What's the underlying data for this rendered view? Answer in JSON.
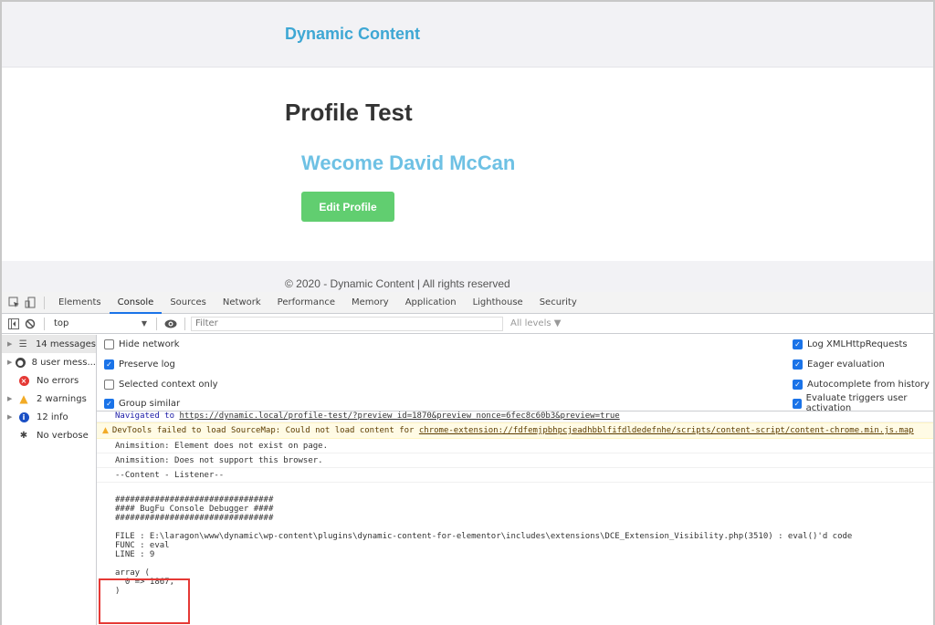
{
  "site": {
    "brand": "Dynamic Content",
    "page_title": "Profile Test",
    "welcome": "Wecome David McCan",
    "edit_button": "Edit Profile",
    "footer": "© 2020 - Dynamic Content | All rights reserved",
    "colors": {
      "brand": "#3ea7d4",
      "welcome": "#6ec1e4",
      "button": "#61ce70"
    }
  },
  "devtools": {
    "tabs": [
      "Elements",
      "Console",
      "Sources",
      "Network",
      "Performance",
      "Memory",
      "Application",
      "Lighthouse",
      "Security"
    ],
    "active_tab": "Console",
    "toolbar": {
      "context": "top",
      "filter_placeholder": "Filter",
      "levels": "All levels ▼"
    },
    "sidebar": [
      {
        "label": "14 messages",
        "icon": "list-icon"
      },
      {
        "label": "8 user mess...",
        "icon": "user-icon"
      },
      {
        "label": "No errors",
        "icon": "error-icon"
      },
      {
        "label": "2 warnings",
        "icon": "warning-icon"
      },
      {
        "label": "12 info",
        "icon": "info-icon"
      },
      {
        "label": "No verbose",
        "icon": "bug-icon"
      }
    ],
    "settings_left": [
      {
        "label": "Hide network",
        "checked": false
      },
      {
        "label": "Preserve log",
        "checked": true
      },
      {
        "label": "Selected context only",
        "checked": false
      },
      {
        "label": "Group similar",
        "checked": true
      }
    ],
    "settings_right": [
      {
        "label": "Log XMLHttpRequests",
        "checked": true
      },
      {
        "label": "Eager evaluation",
        "checked": true
      },
      {
        "label": "Autocomplete from history",
        "checked": true
      },
      {
        "label": "Evaluate triggers user activation",
        "checked": true
      }
    ],
    "console": {
      "nav_prefix": "Navigated to ",
      "nav_url": "https://dynamic.local/profile-test/?preview_id=1870&preview_nonce=6fec8c60b3&preview=true",
      "warn_text": "DevTools failed to load SourceMap: Could not load content for ",
      "warn_url": "chrome-extension://fdfemjpbhpcjeadhbblfifdldedefnhe/scripts/content-script/content-chrome.min.js.map",
      "msg1": "Animsition: Element does not exist on page.",
      "msg2": "Animsition: Does not support this browser.",
      "msg3": "--Content - Listener--",
      "debug_block": "################################\n#### BugFu Console Debugger ####\n################################\n\nFILE : E:\\laragon\\www\\dynamic\\wp-content\\plugins\\dynamic-content-for-elementor\\includes\\extensions\\DCE_Extension_Visibility.php(3510) : eval()'d code\nFUNC : eval\nLINE : 9\n\narray (\n  0 => 1867,\n)"
    }
  }
}
